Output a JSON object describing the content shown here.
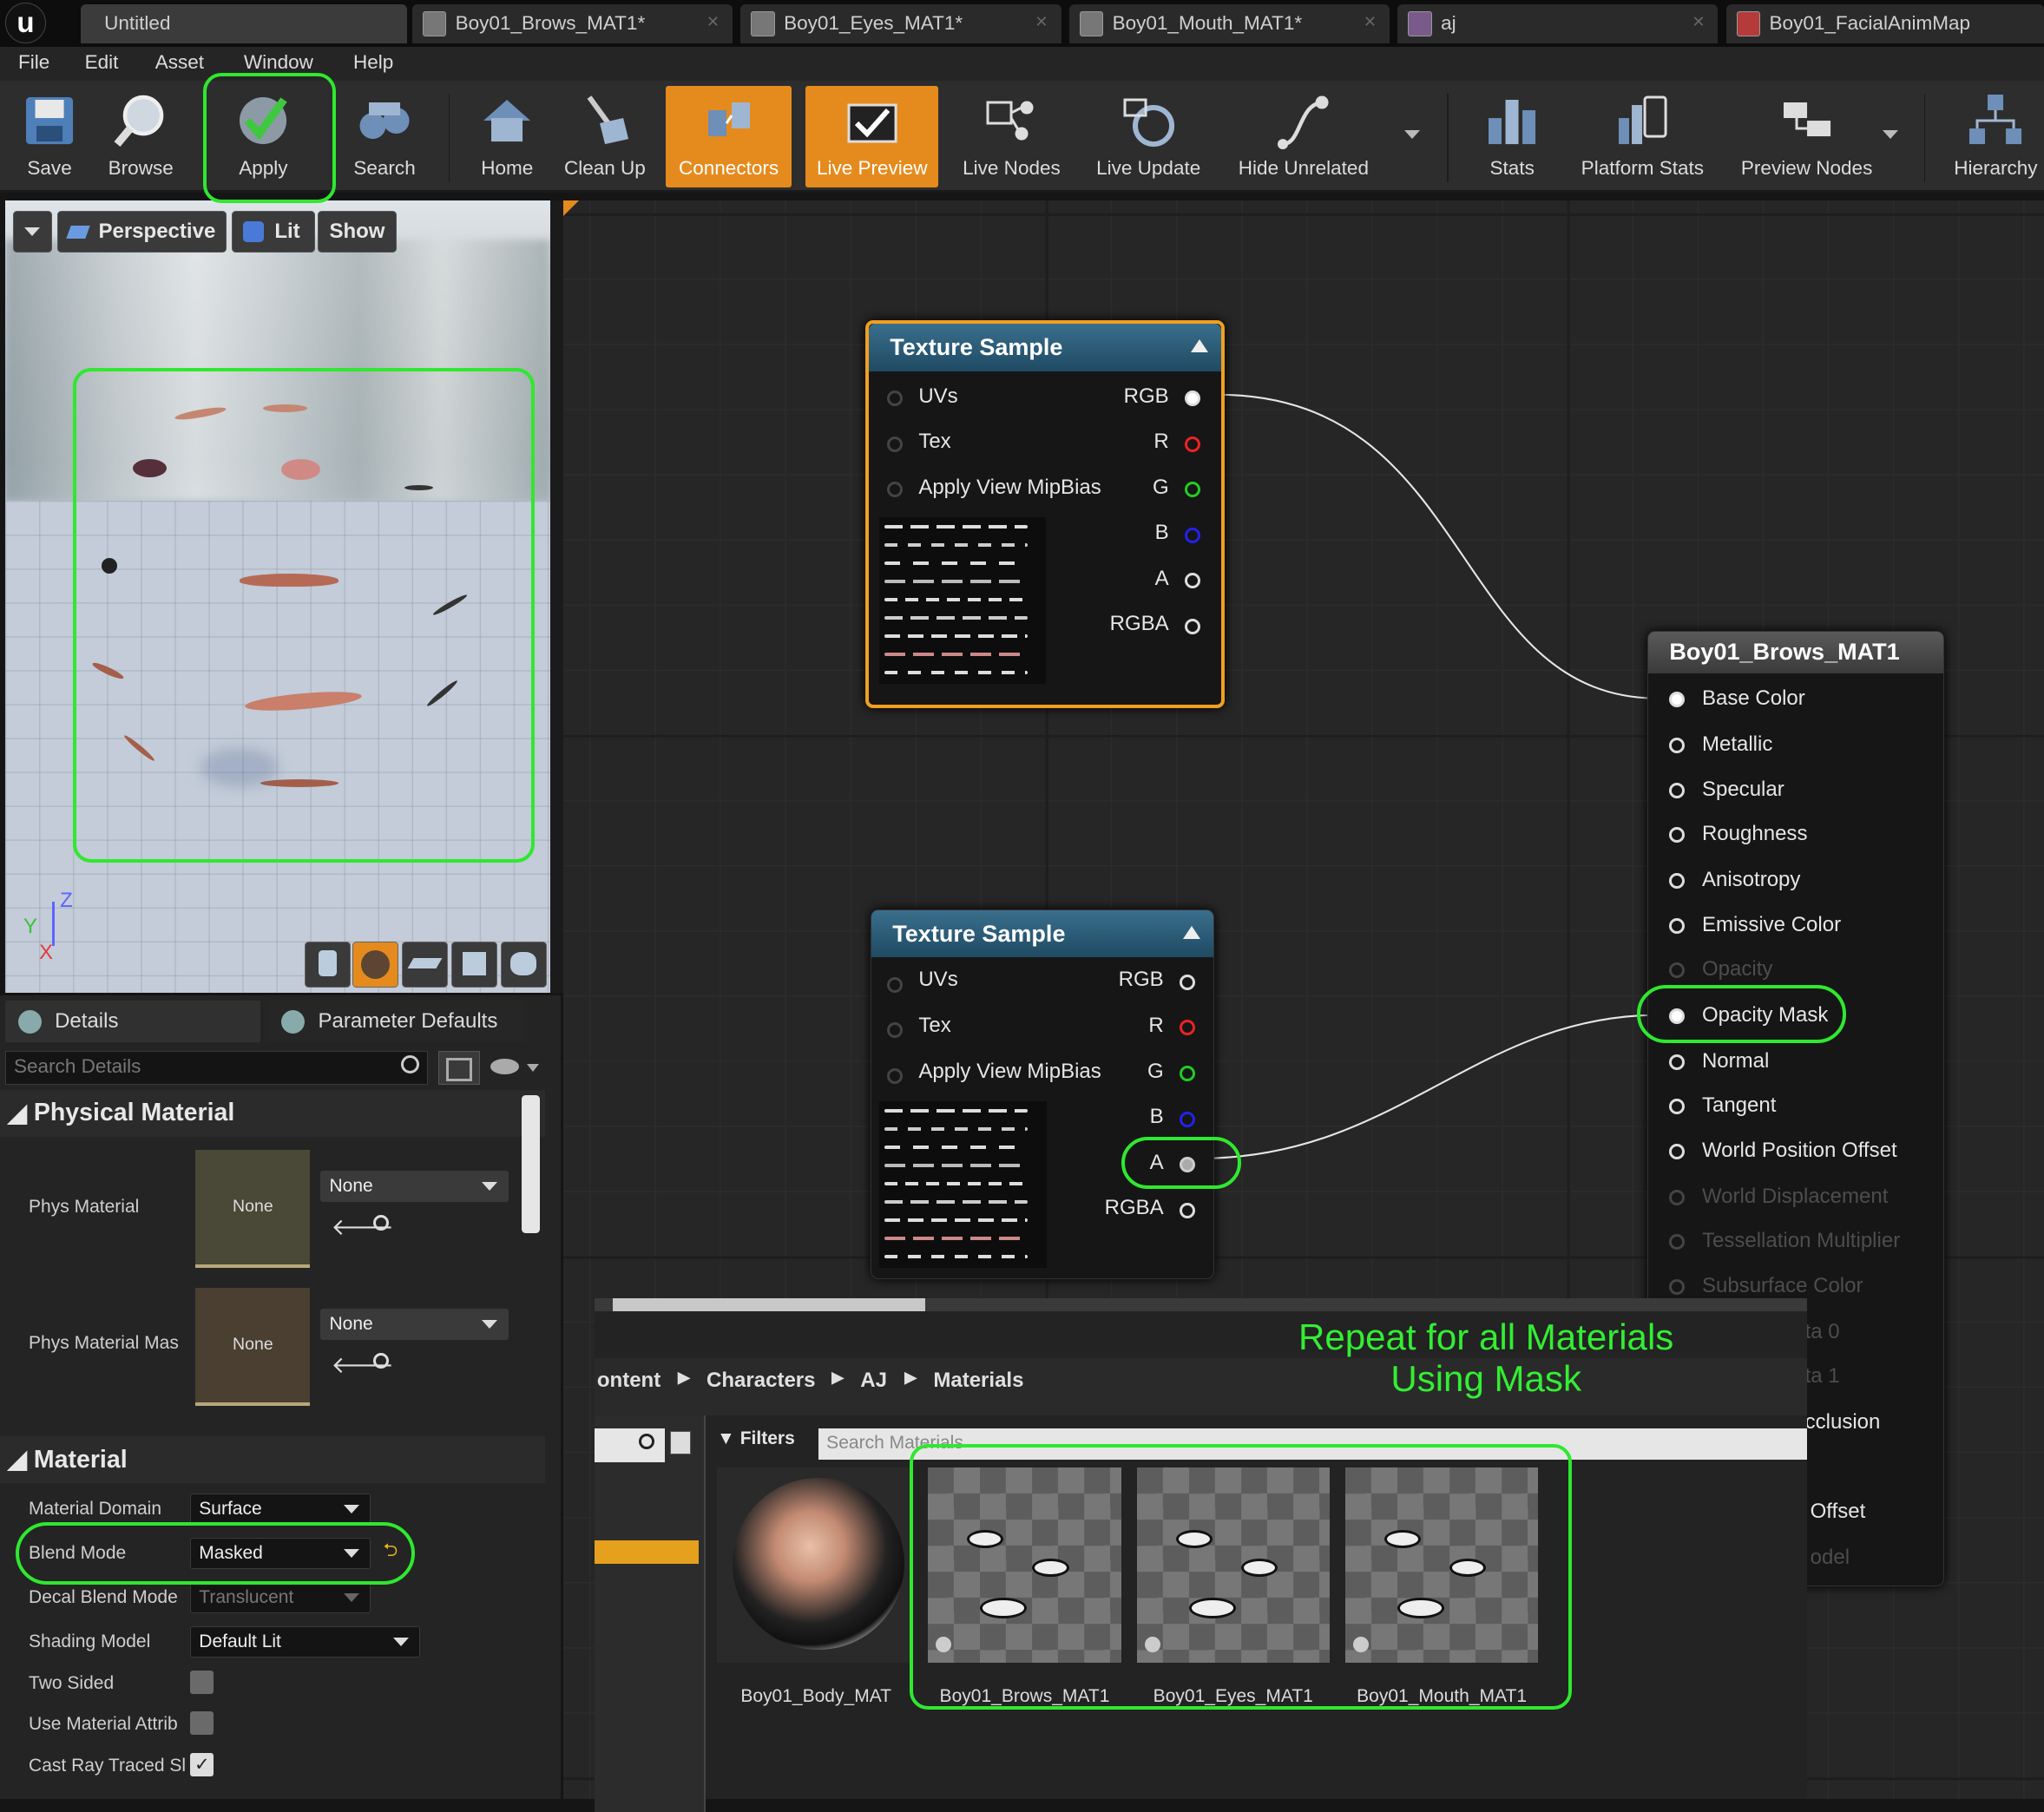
{
  "tabs": [
    {
      "label": "Untitled"
    },
    {
      "label": "Boy01_Brows_MAT1*"
    },
    {
      "label": "Boy01_Eyes_MAT1*"
    },
    {
      "label": "Boy01_Mouth_MAT1*"
    },
    {
      "label": "aj"
    },
    {
      "label": "Boy01_FacialAnimMap"
    }
  ],
  "menu": [
    "File",
    "Edit",
    "Asset",
    "Window",
    "Help"
  ],
  "toolbar": {
    "save": "Save",
    "browse": "Browse",
    "apply": "Apply",
    "search": "Search",
    "home": "Home",
    "cleanup": "Clean Up",
    "connectors": "Connectors",
    "live_preview": "Live Preview",
    "live_nodes": "Live Nodes",
    "live_update": "Live Update",
    "hide_unrelated": "Hide Unrelated",
    "stats": "Stats",
    "platform_stats": "Platform Stats",
    "preview_nodes": "Preview Nodes",
    "hierarchy": "Hierarchy"
  },
  "viewport": {
    "perspective": "Perspective",
    "lit": "Lit",
    "show": "Show",
    "axis_z": "Z",
    "axis_y": "Y",
    "axis_x": "X"
  },
  "details": {
    "tab_details": "Details",
    "tab_params": "Parameter Defaults",
    "search_placeholder": "Search Details",
    "section_physical": "Physical Material",
    "phys_material": "Phys Material",
    "phys_material_mask": "Phys Material Mas",
    "none": "None",
    "section_material": "Material",
    "material_domain": "Material Domain",
    "material_domain_value": "Surface",
    "blend_mode": "Blend Mode",
    "blend_mode_value": "Masked",
    "decal_blend_mode": "Decal Blend Mode",
    "decal_blend_mode_value": "Translucent",
    "shading_model": "Shading Model",
    "shading_model_value": "Default Lit",
    "two_sided": "Two Sided",
    "use_material_attrib": "Use Material Attrib",
    "cast_ray_traced": "Cast Ray Traced Sl"
  },
  "nodes": {
    "ts_title": "Texture Sample",
    "uvs": "UVs",
    "tex": "Tex",
    "mip": "Apply View MipBias",
    "rgb": "RGB",
    "r": "R",
    "g": "G",
    "b": "B",
    "a": "A",
    "rgba": "RGBA",
    "mat_title": "Boy01_Brows_MAT1",
    "mat_pins": [
      "Base Color",
      "Metallic",
      "Specular",
      "Roughness",
      "Anisotropy",
      "Emissive Color",
      "Opacity",
      "Opacity Mask",
      "Normal",
      "Tangent",
      "World Position Offset",
      "World Displacement",
      "Tessellation Multiplier",
      "Subsurface Color"
    ],
    "mat_pins_hidden_tail": [
      "ta 0",
      "ta 1",
      "cclusion",
      "Offset",
      "odel"
    ]
  },
  "content_browser": {
    "crumbs": [
      "ontent",
      "Characters",
      "AJ",
      "Materials"
    ],
    "filters": "Filters",
    "search_placeholder": "Search Materials",
    "assets": [
      "Boy01_Body_MAT",
      "Boy01_Brows_MAT1",
      "Boy01_Eyes_MAT1",
      "Boy01_Mouth_MAT1"
    ]
  },
  "annotation": {
    "line1": "Repeat for all Materials",
    "line2": "Using Mask"
  },
  "colors": {
    "accent_orange": "#e58b1d",
    "highlight_green": "#2fe82f",
    "node_header": "#2b5c78"
  }
}
